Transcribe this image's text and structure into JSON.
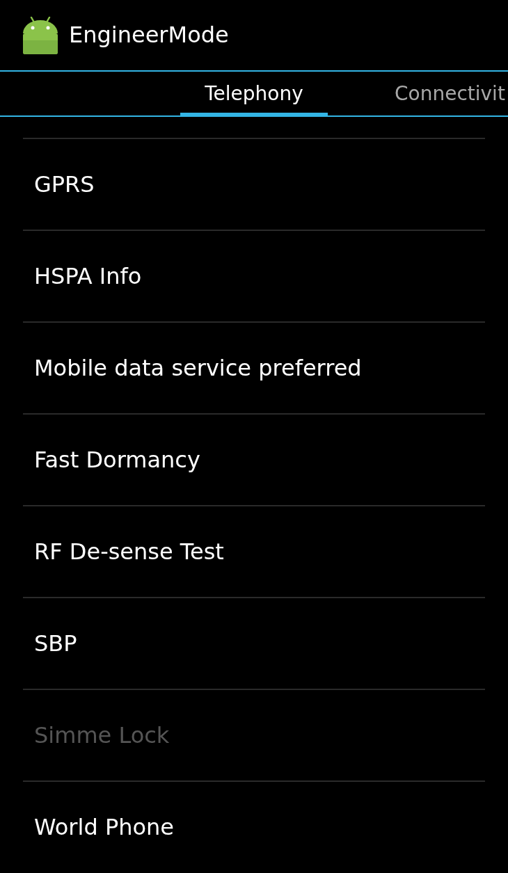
{
  "action_bar": {
    "title": "EngineerMode"
  },
  "tabs": [
    {
      "label": "Telephony",
      "selected": true
    },
    {
      "label": "Connectivit",
      "selected": false
    }
  ],
  "items": [
    {
      "label": "GPRS",
      "disabled": false
    },
    {
      "label": "HSPA Info",
      "disabled": false
    },
    {
      "label": "Mobile data service preferred",
      "disabled": false
    },
    {
      "label": "Fast Dormancy",
      "disabled": false
    },
    {
      "label": "RF De-sense Test",
      "disabled": false
    },
    {
      "label": "SBP",
      "disabled": false
    },
    {
      "label": "Simme Lock",
      "disabled": true
    },
    {
      "label": "World Phone",
      "disabled": false
    }
  ]
}
